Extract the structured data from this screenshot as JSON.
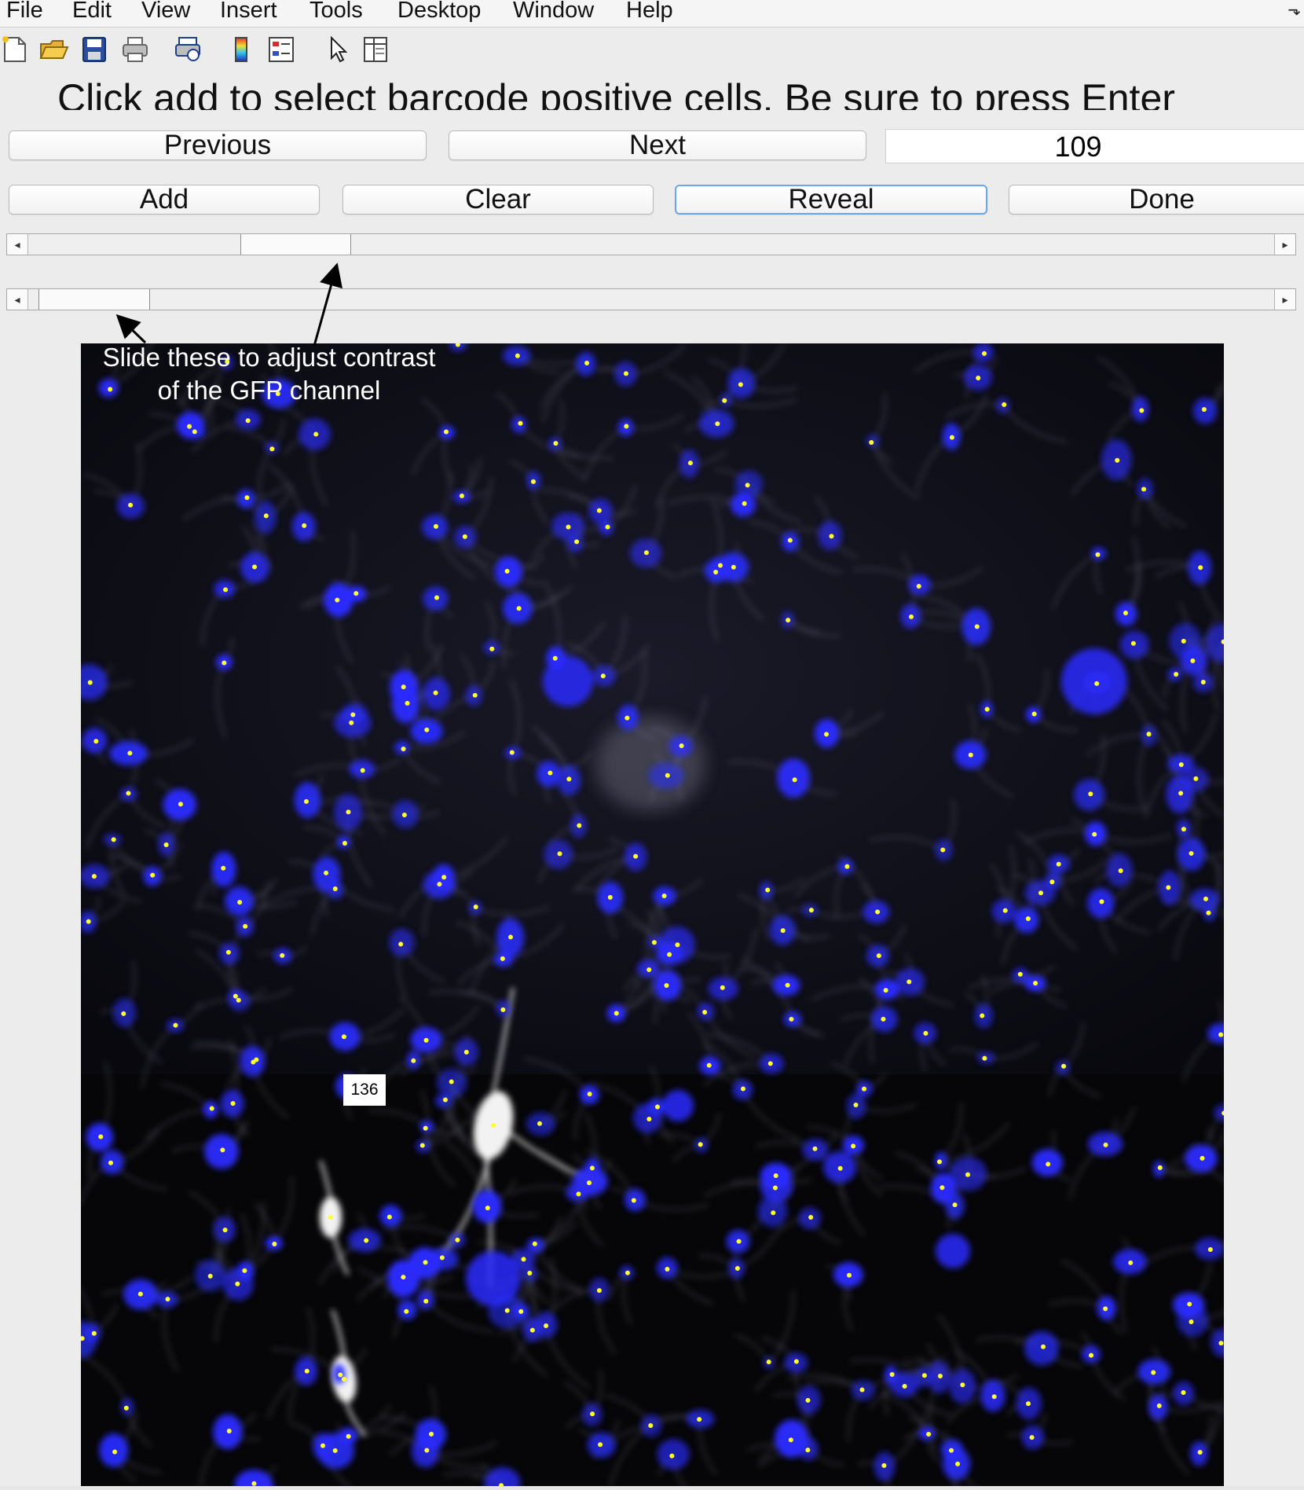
{
  "menu": {
    "items": [
      "File",
      "Edit",
      "View",
      "Insert",
      "Tools",
      "Desktop",
      "Window",
      "Help"
    ]
  },
  "toolbar": {
    "icons": [
      "new-figure-icon",
      "open-file-icon",
      "save-icon",
      "print-icon",
      "print-preview-icon",
      "colorbar-icon",
      "legend-icon",
      "pointer-icon",
      "property-inspector-icon"
    ]
  },
  "instruction": "Click add to select barcode positive cells. Be sure to press Enter",
  "nav": {
    "previous_label": "Previous",
    "next_label": "Next",
    "index_value": "109"
  },
  "actions": {
    "add_label": "Add",
    "clear_label": "Clear",
    "reveal_label": "Reveal",
    "done_label": "Done"
  },
  "sliders": {
    "upper_position": 0.17,
    "lower_position": 0.008
  },
  "annotation": {
    "line1": "Slide these to adjust contrast",
    "line2": "of the GFP channel"
  },
  "image": {
    "cell_label": "136",
    "nucleus_color": "#2a2cff",
    "marker_color": "#ffff30",
    "gfp_color": "#ffffff"
  }
}
